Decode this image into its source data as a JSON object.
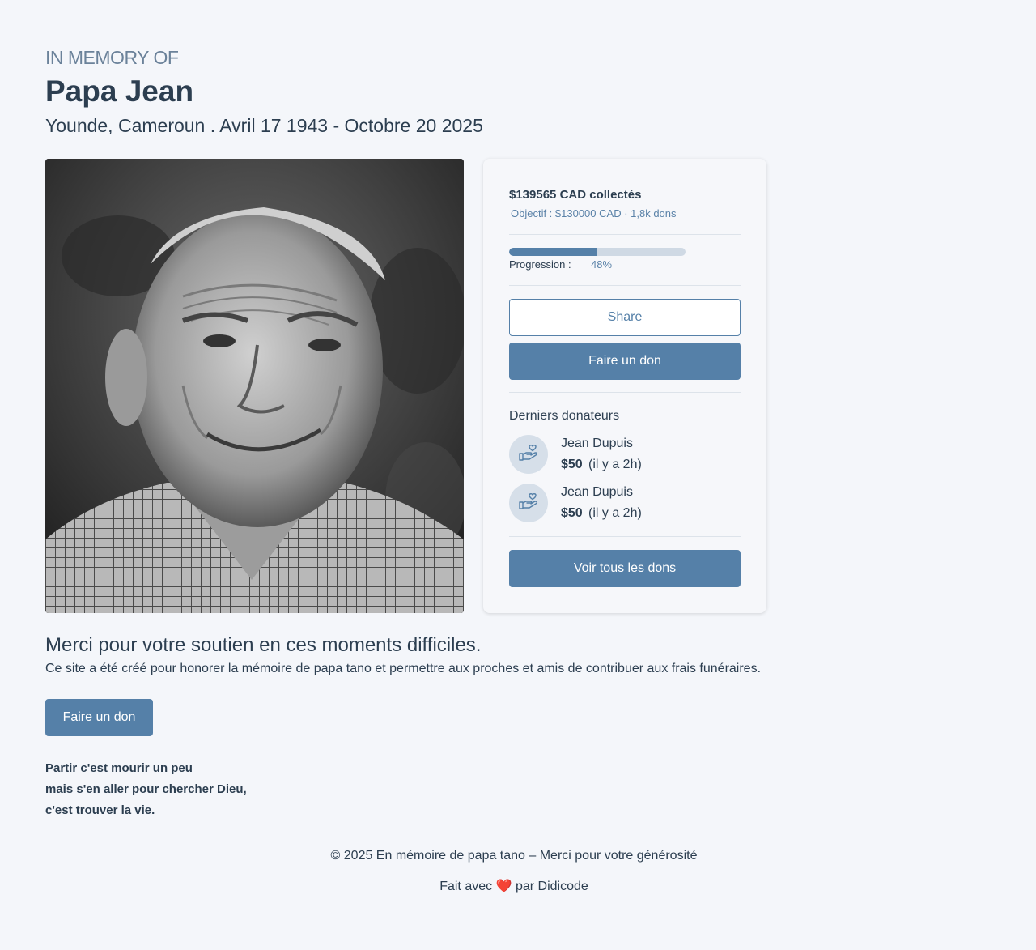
{
  "header": {
    "eyebrow": "IN MEMORY OF",
    "name": "Papa Jean",
    "subline": "Younde, Cameroun . Avril 17 1943 - Octobre 20 2025"
  },
  "photo": {
    "alt": "Portrait de Papa Jean"
  },
  "card": {
    "raised": "$139565 CAD collectés",
    "goal": "Objectif : $130000 CAD · 1,8k dons",
    "progress_label": "Progression :",
    "progress_value": "48%",
    "progress_fraction": 0.5,
    "share_label": "Share",
    "donate_label": "Faire un don",
    "donors_title": "Derniers donateurs",
    "donors": [
      {
        "name": "Jean Dupuis",
        "amount": "$50",
        "time": "(il y a 2h)",
        "icon": "hand-heart-icon"
      },
      {
        "name": "Jean Dupuis",
        "amount": "$50",
        "time": "(il y a 2h)",
        "icon": "hand-heart-icon"
      }
    ],
    "all_donations_label": "Voir tous les dons"
  },
  "main": {
    "thanks": "Merci pour votre soutien en ces moments difficiles.",
    "description": "Ce site a été créé pour honorer la mémoire de papa tano et permettre aux proches et amis de contribuer aux frais funéraires.",
    "donate_label": "Faire un don",
    "poem": [
      "Partir c'est mourir un peu",
      "mais s'en aller pour chercher Dieu,",
      "c'est trouver la vie."
    ]
  },
  "footer": {
    "copyright": "© 2025 En mémoire de papa tano – Merci pour votre générosité",
    "made_with_prefix": "Fait avec",
    "heart": "❤️",
    "made_with_suffix": "par Didicode"
  },
  "colors": {
    "accent": "#5580a8",
    "background": "#f4f6fa",
    "text": "#2c3e50",
    "muted": "#6b829a"
  }
}
